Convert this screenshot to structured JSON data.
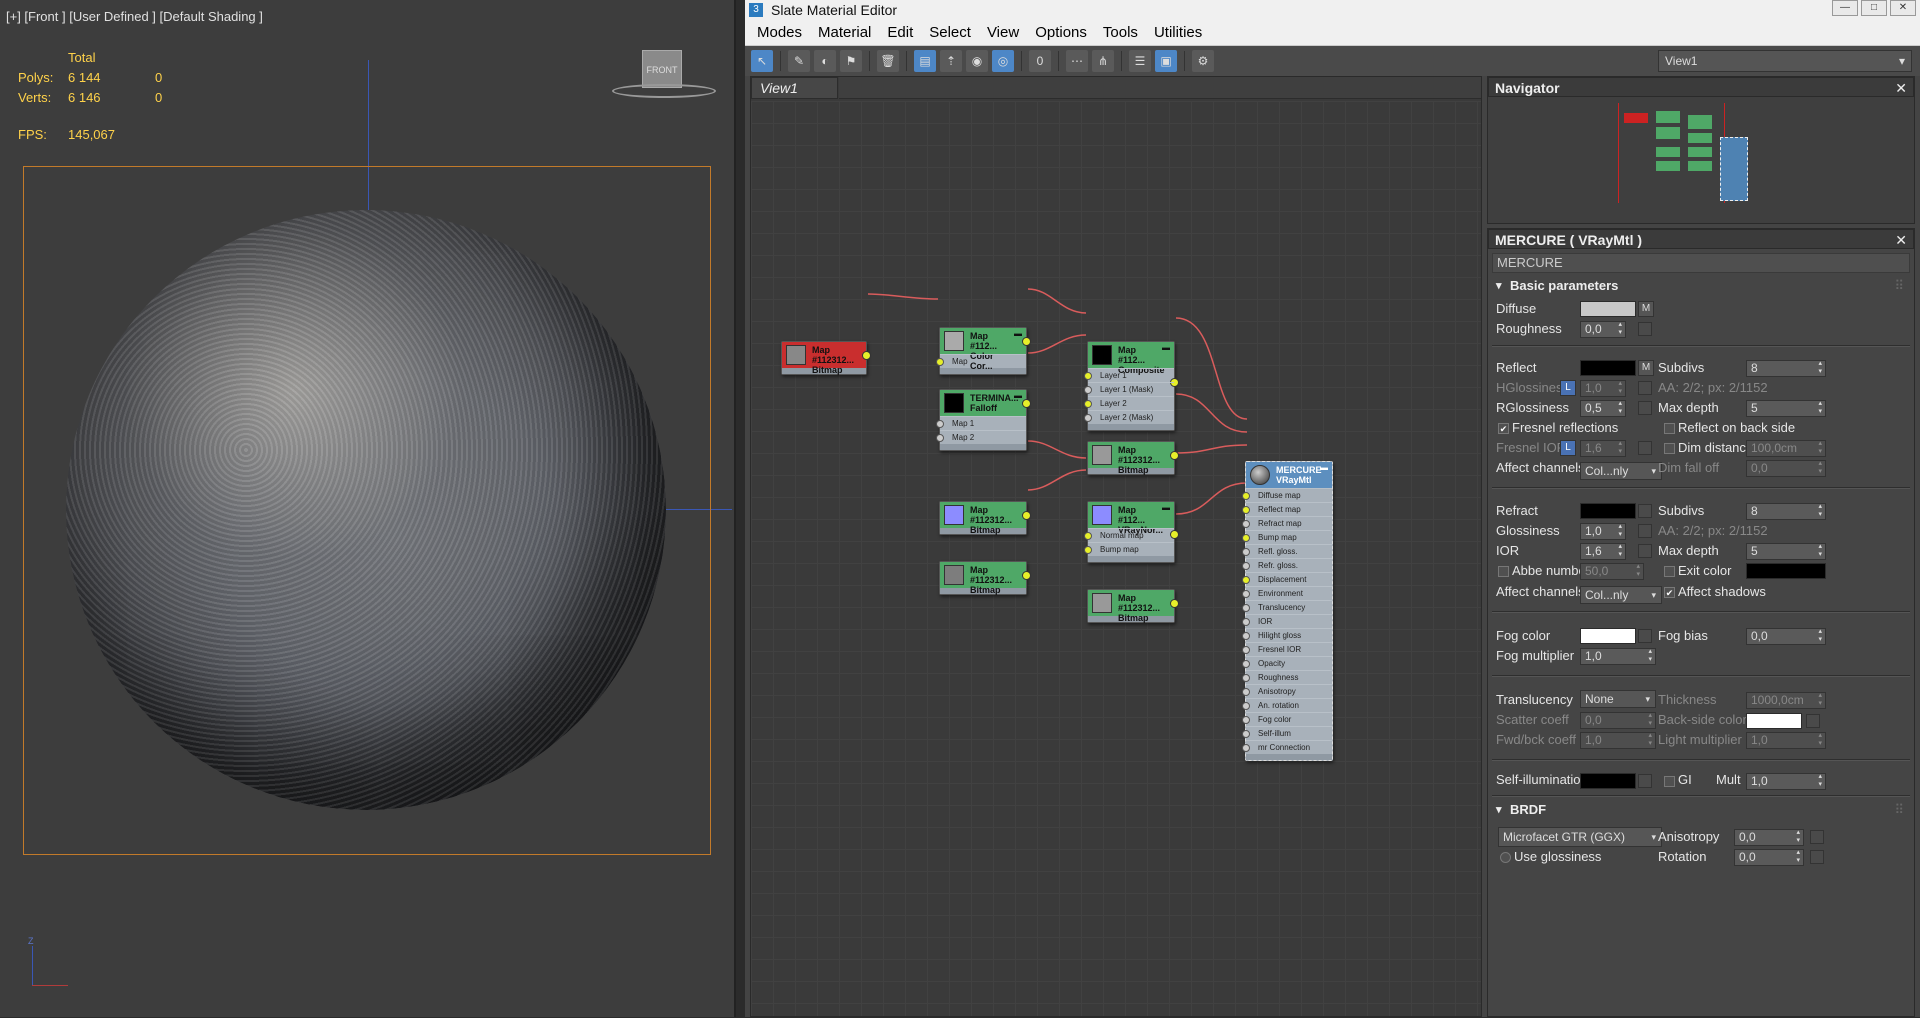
{
  "viewport": {
    "label": "[+] [Front ] [User Defined ] [Default Shading ]",
    "stats_header": "Total",
    "polys_label": "Polys:",
    "polys_total": "6 144",
    "polys_sel": "0",
    "verts_label": "Verts:",
    "verts_total": "6 146",
    "verts_sel": "0",
    "fps_label": "FPS:",
    "fps_value": "145,067",
    "viewcube_face": "FRONT",
    "axis_z": "Z",
    "stats_color": "#ffd24a",
    "frame_color": "#c27a2a"
  },
  "window": {
    "title": "Slate Material Editor",
    "minimize": "—",
    "maximize": "□",
    "close": "✕"
  },
  "menu": [
    "Modes",
    "Material",
    "Edit",
    "Select",
    "View",
    "Options",
    "Tools",
    "Utilities"
  ],
  "toolbar": {
    "view_select": "View1"
  },
  "canvas": {
    "tab": "View1"
  },
  "nodes": {
    "n1": {
      "title": "Map #112312...",
      "sub": "Bitmap"
    },
    "n2": {
      "title": "Map #112...",
      "sub": "Color Cor...",
      "slot1": "Map"
    },
    "n3": {
      "title": "TERMINA...",
      "sub": "Falloff",
      "slot1": "Map 1",
      "slot2": "Map 2"
    },
    "n4": {
      "title": "Map #112...",
      "sub": "Composite",
      "slot1": "Layer 1",
      "slot2": "Layer 1 (Mask)",
      "slot3": "Layer 2",
      "slot4": "Layer 2 (Mask)"
    },
    "n5": {
      "title": "Map #112312...",
      "sub": "Bitmap"
    },
    "n6": {
      "title": "Map #112312...",
      "sub": "Bitmap"
    },
    "n7": {
      "title": "Map #112...",
      "sub": "VRayNor...",
      "slot1": "Normal map",
      "slot2": "Bump map"
    },
    "n8": {
      "title": "Map #112312...",
      "sub": "Bitmap"
    },
    "n9": {
      "title": "Map #112312...",
      "sub": "Bitmap"
    },
    "mat": {
      "title": "MERCURE",
      "sub": "VRayMtl",
      "slots": [
        "Diffuse map",
        "Reflect map",
        "Refract map",
        "Bump map",
        "Refl. gloss.",
        "Refr. gloss.",
        "Displacement",
        "Environment",
        "Translucency",
        "IOR",
        "Hilight gloss",
        "Fresnel IOR",
        "Opacity",
        "Roughness",
        "Anisotropy",
        "An. rotation",
        "Fog color",
        "Self-illum",
        "mr Connection"
      ]
    }
  },
  "navigator": {
    "title": "Navigator",
    "close": "✕"
  },
  "params": {
    "header": "MERCURE  ( VRayMtl )",
    "close": "✕",
    "name_field": "MERCURE",
    "basic_rollout": "Basic parameters",
    "diffuse": "Diffuse",
    "diffuse_color": "#c8c8c8",
    "roughness": "Roughness",
    "roughness_val": "0,0",
    "reflect": "Reflect",
    "reflect_color": "#000000",
    "subdivs": "Subdivs",
    "refl_subdivs": "8",
    "hglossiness": "HGlossiness",
    "hgloss_val": "1,0",
    "aa_refl": "AA: 2/2; px: 2/1152",
    "rglossiness": "RGlossiness",
    "rgloss_val": "0,5",
    "max_depth": "Max depth",
    "refl_maxdepth": "5",
    "fresnel": "Fresnel reflections",
    "reflect_back": "Reflect on back side",
    "fresnel_ior": "Fresnel IOR",
    "fresnel_ior_val": "1,6",
    "dim_distance": "Dim distance",
    "dim_distance_val": "100,0cm",
    "affect_channels": "Affect channels",
    "affect_val": "Col...nly",
    "dim_falloff": "Dim fall off",
    "dim_falloff_val": "0,0",
    "refract": "Refract",
    "refract_color": "#000000",
    "refr_subdivs": "8",
    "glossiness": "Glossiness",
    "gloss_val": "1,0",
    "aa_refr": "AA: 2/2; px: 2/1152",
    "ior": "IOR",
    "ior_val": "1,6",
    "refr_maxdepth": "5",
    "abbe": "Abbe number",
    "abbe_val": "50,0",
    "exit_color": "Exit color",
    "exit_color_val": "#000000",
    "affect_channels2": "Affect channels",
    "affect_val2": "Col...nly",
    "affect_shadows": "Affect shadows",
    "fog_color": "Fog color",
    "fog_color_val": "#ffffff",
    "fog_bias": "Fog bias",
    "fog_bias_val": "0,0",
    "fog_mult": "Fog multiplier",
    "fog_mult_val": "1,0",
    "translucency": "Translucency",
    "translucency_val": "None",
    "thickness": "Thickness",
    "thickness_val": "1000,0cm",
    "scatter": "Scatter coeff",
    "scatter_val": "0,0",
    "backside": "Back-side color",
    "backside_color": "#ffffff",
    "fwdbck": "Fwd/bck coeff",
    "fwdbck_val": "1,0",
    "light_mult": "Light multiplier",
    "light_mult_val": "1,0",
    "self_illum": "Self-illumination",
    "self_illum_color": "#000000",
    "gi": "GI",
    "mult": "Mult",
    "mult_val": "1,0",
    "brdf_rollout": "BRDF",
    "brdf_type": "Microfacet GTR (GGX)",
    "anisotropy": "Anisotropy",
    "anisotropy_val": "0,0",
    "use_gloss": "Use glossiness",
    "rotation": "Rotation",
    "rotation_val": "0,0",
    "m": "M",
    "l": "L"
  }
}
